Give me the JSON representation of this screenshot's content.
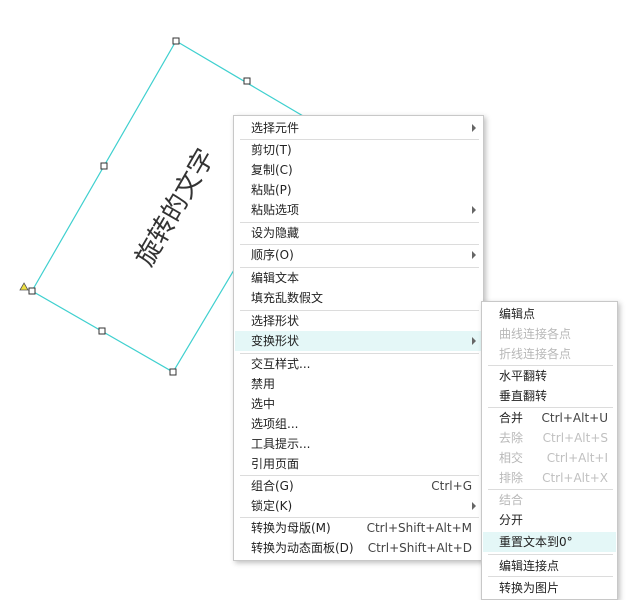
{
  "shape": {
    "text": "旋转的文字",
    "line_color": "#3fd0cf",
    "handle_color": "#333333",
    "anchor_color": "#f0e040"
  },
  "main_menu": {
    "items": [
      {
        "label": "选择元件",
        "submenu": true
      },
      {
        "label": "剪切(T)"
      },
      {
        "label": "复制(C)"
      },
      {
        "label": "粘贴(P)"
      },
      {
        "label": "粘贴选项",
        "submenu": true
      },
      {
        "label": "设为隐藏"
      },
      {
        "label": "顺序(O)",
        "submenu": true
      },
      {
        "label": "编辑文本"
      },
      {
        "label": "填充乱数假文"
      },
      {
        "label": "选择形状"
      },
      {
        "label": "变换形状",
        "submenu": true,
        "highlighted": true
      },
      {
        "label": "交互样式..."
      },
      {
        "label": "禁用"
      },
      {
        "label": "选中"
      },
      {
        "label": "选项组..."
      },
      {
        "label": "工具提示..."
      },
      {
        "label": "引用页面"
      },
      {
        "label": "组合(G)",
        "shortcut": "Ctrl+G"
      },
      {
        "label": "锁定(K)",
        "submenu": true
      },
      {
        "label": "转换为母版(M)",
        "shortcut": "Ctrl+Shift+Alt+M"
      },
      {
        "label": "转换为动态面板(D)",
        "shortcut": "Ctrl+Shift+Alt+D"
      }
    ]
  },
  "sub_menu": {
    "items": [
      {
        "label": "编辑点"
      },
      {
        "label": "曲线连接各点",
        "disabled": true
      },
      {
        "label": "折线连接各点",
        "disabled": true
      },
      {
        "label": "水平翻转"
      },
      {
        "label": "垂直翻转"
      },
      {
        "label": "合并",
        "shortcut": "Ctrl+Alt+U"
      },
      {
        "label": "去除",
        "shortcut": "Ctrl+Alt+S",
        "disabled": true
      },
      {
        "label": "相交",
        "shortcut": "Ctrl+Alt+I",
        "disabled": true
      },
      {
        "label": "排除",
        "shortcut": "Ctrl+Alt+X",
        "disabled": true
      },
      {
        "label": "结合",
        "disabled": true
      },
      {
        "label": "分开"
      },
      {
        "label": "重置文本到0°",
        "highlighted": true
      },
      {
        "label": "编辑连接点"
      },
      {
        "label": "转换为图片"
      }
    ]
  }
}
